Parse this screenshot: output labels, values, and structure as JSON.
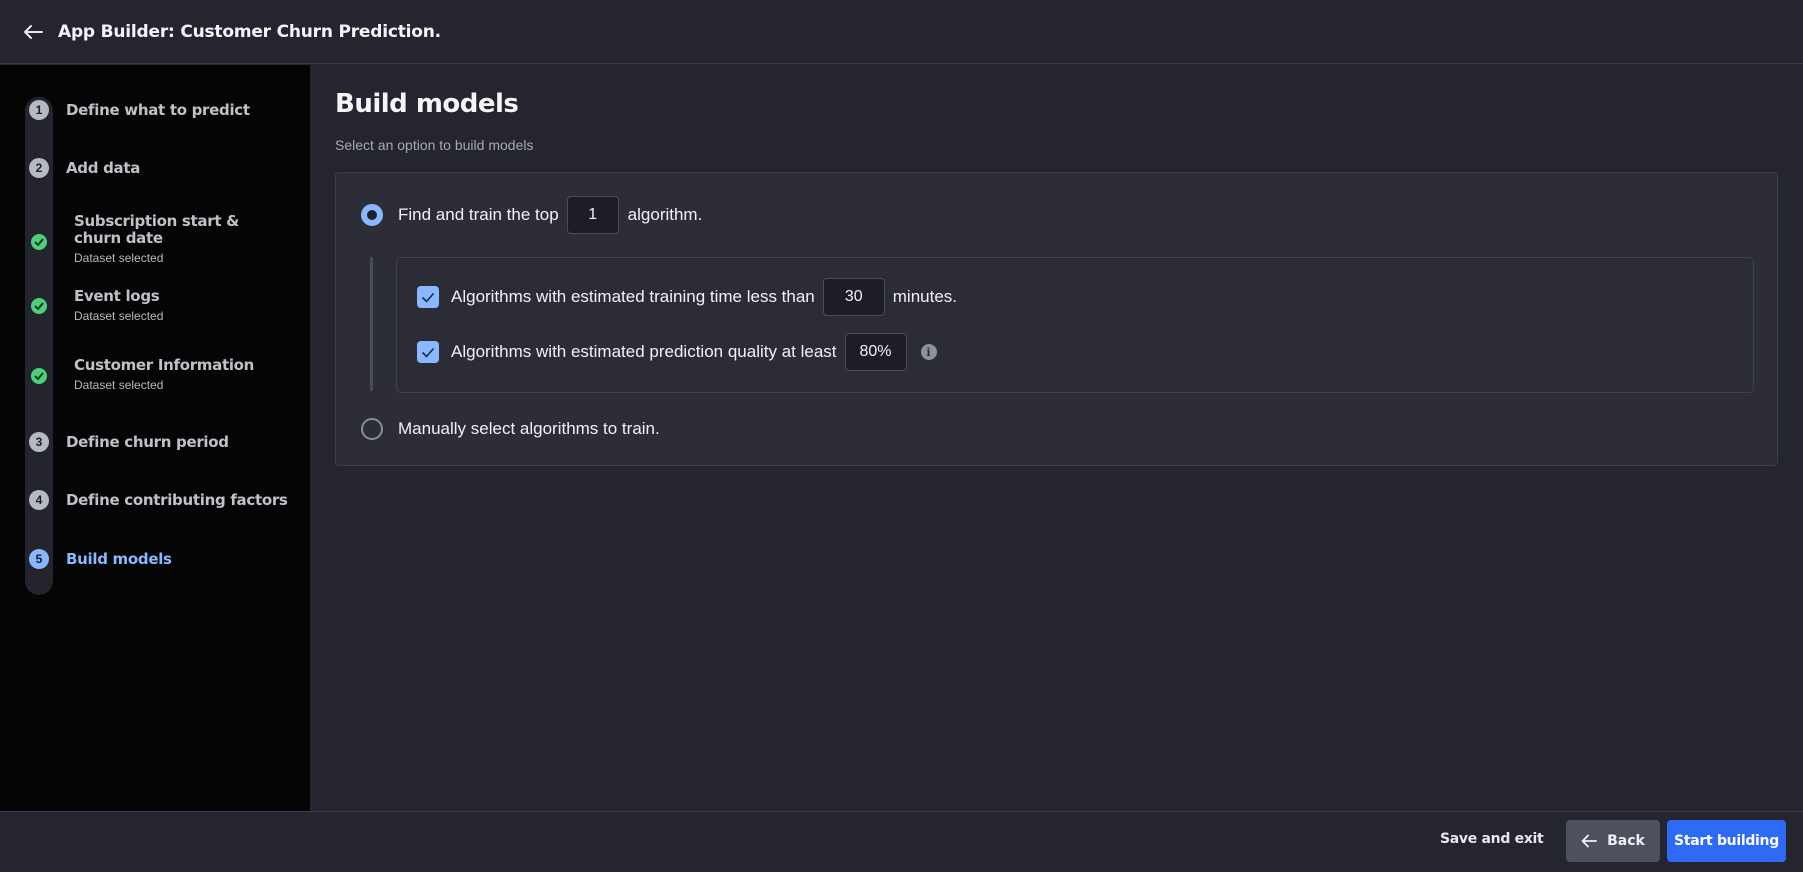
{
  "header": {
    "title": "App Builder: Customer Churn Prediction."
  },
  "sidebar": {
    "steps": [
      {
        "number": "1",
        "label": "Define what to predict"
      },
      {
        "number": "2",
        "label": "Add data"
      },
      {
        "number": "3",
        "label": "Define churn period"
      },
      {
        "number": "4",
        "label": "Define contributing factors"
      },
      {
        "number": "5",
        "label": "Build models"
      }
    ],
    "datasets": [
      {
        "label": "Subscription start & churn date",
        "status": "Dataset selected"
      },
      {
        "label": "Event logs",
        "status": "Dataset selected"
      },
      {
        "label": "Customer Information",
        "status": "Dataset selected"
      }
    ]
  },
  "main": {
    "title": "Build models",
    "subtitle": "Select an option to build models",
    "option_auto": {
      "prefix": "Find and train the top",
      "top_n": "1",
      "suffix": "algorithm."
    },
    "criteria": {
      "time": {
        "prefix": "Algorithms with estimated training time less than",
        "value": "30",
        "suffix": "minutes."
      },
      "quality": {
        "prefix": "Algorithms with estimated prediction quality at least",
        "value": "80%"
      }
    },
    "option_manual": {
      "label": "Manually select algorithms to train."
    }
  },
  "footer": {
    "save_exit": "Save and exit",
    "back": "Back",
    "start": "Start building"
  },
  "colors": {
    "accent": "#8ab8ff",
    "primary_button": "#2d6af5",
    "success": "#4bd07b"
  }
}
